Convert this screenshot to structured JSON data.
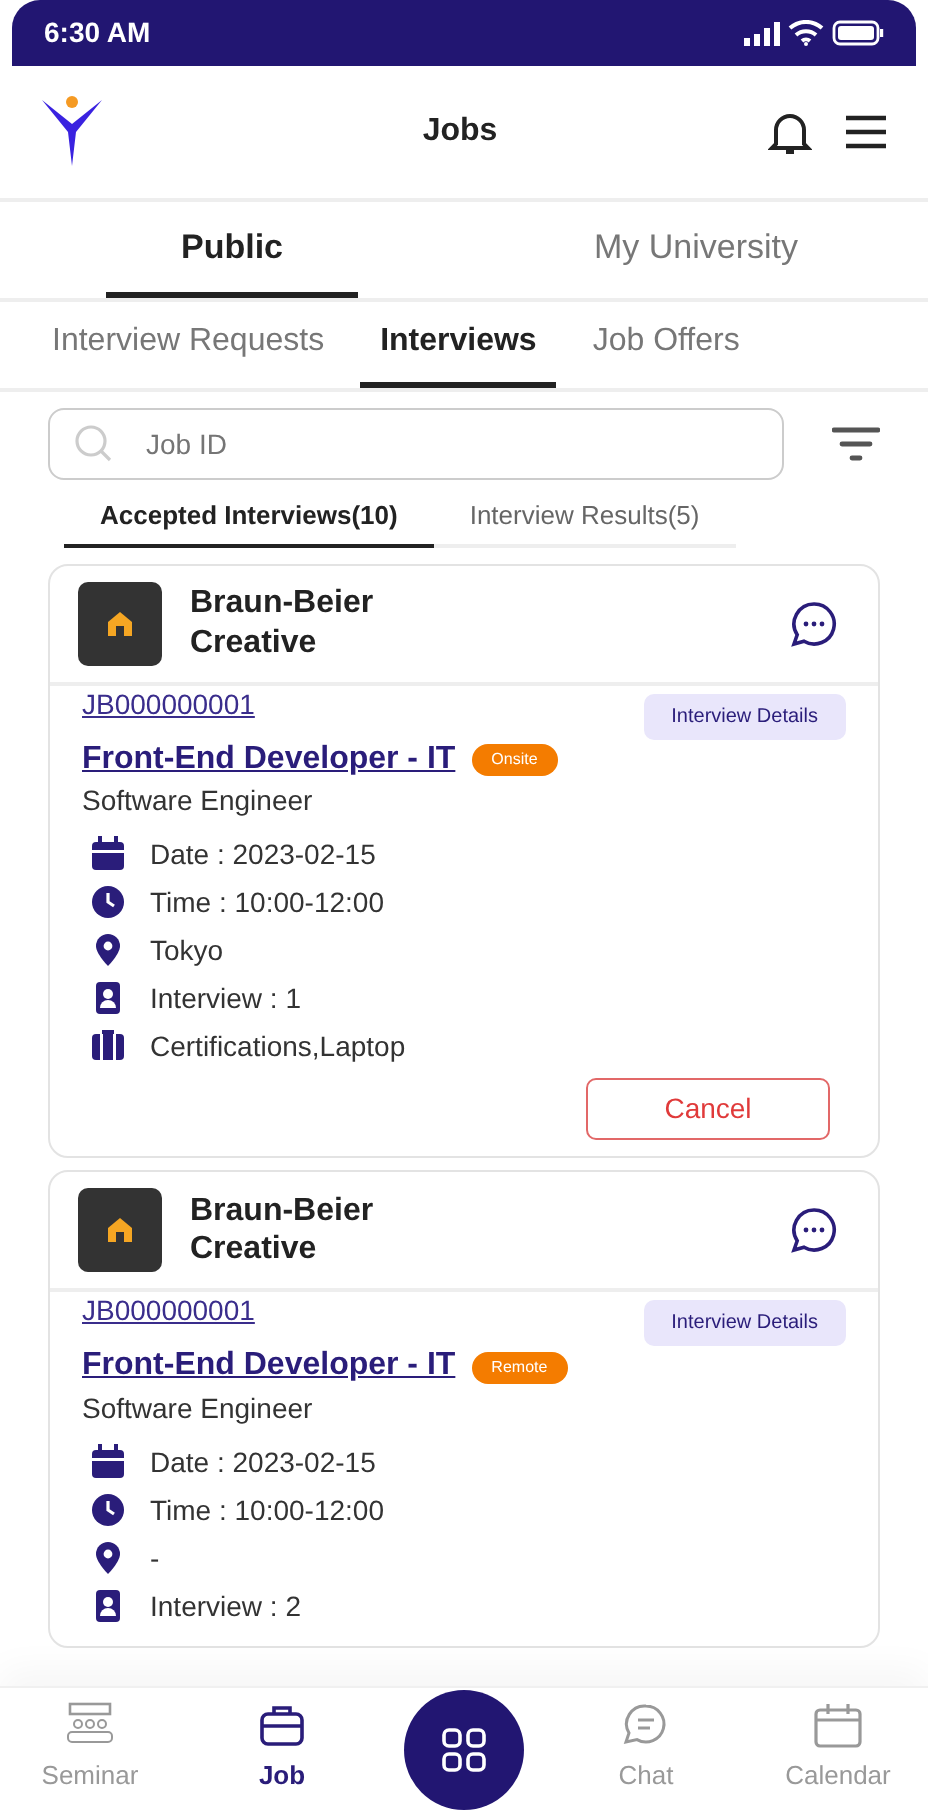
{
  "status_bar": {
    "time": "6:30 AM"
  },
  "header": {
    "title": "Jobs"
  },
  "main_tabs": [
    {
      "label": "Public",
      "selected": true
    },
    {
      "label": "My University",
      "selected": false
    }
  ],
  "sub_tabs": [
    {
      "label": "Interview Requests",
      "selected": false
    },
    {
      "label": "Interviews",
      "selected": true
    },
    {
      "label": "Job Offers",
      "selected": false
    }
  ],
  "search": {
    "placeholder": "Job ID"
  },
  "filter_tabs": [
    {
      "label": "Accepted Interviews(10)",
      "selected": true
    },
    {
      "label": "Interview Results(5)",
      "selected": false
    }
  ],
  "cards": [
    {
      "company": "Braun-Beier Creative",
      "job_id": "JB000000001",
      "title": "Front-End Developer - IT",
      "badge": "Onsite",
      "role": "Software Engineer",
      "details_button": "Interview Details",
      "details": [
        {
          "kind": "date",
          "text": "Date : 2023-02-15"
        },
        {
          "kind": "time",
          "text": "Time : 10:00-12:00"
        },
        {
          "kind": "location",
          "text": "Tokyo"
        },
        {
          "kind": "interview",
          "text": "Interview : 1"
        },
        {
          "kind": "items",
          "text": "Certifications,Laptop"
        }
      ],
      "cancel_button": "Cancel"
    },
    {
      "company": "Braun-Beier Creative",
      "job_id": "JB000000001",
      "title": "Front-End Developer - IT",
      "badge": "Remote",
      "role": "Software Engineer",
      "details_button": "Interview Details",
      "details": [
        {
          "kind": "date",
          "text": "Date : 2023-02-15"
        },
        {
          "kind": "time",
          "text": "Time : 10:00-12:00"
        },
        {
          "kind": "location",
          "text": "-"
        },
        {
          "kind": "interview",
          "text": "Interview : 2"
        }
      ]
    }
  ],
  "bottom_nav": [
    {
      "kind": "seminar",
      "label": "Seminar",
      "selected": false
    },
    {
      "kind": "job",
      "label": "Job",
      "selected": true
    },
    {
      "kind": "center"
    },
    {
      "kind": "chat",
      "label": "Chat",
      "selected": false
    },
    {
      "kind": "calendar",
      "label": "Calendar",
      "selected": false
    }
  ]
}
